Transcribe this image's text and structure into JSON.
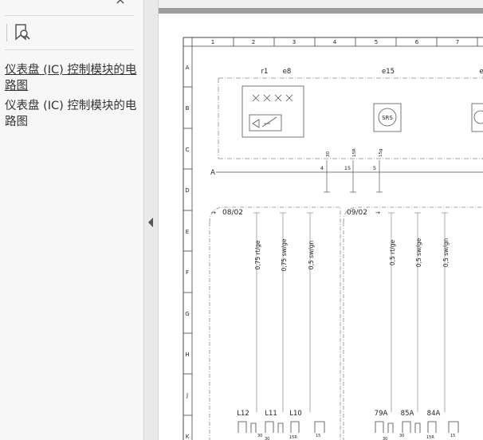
{
  "sidebar": {
    "close_glyph": "×",
    "bookmarks": [
      "仪表盘 (IC) 控制模块的电路图",
      "仪表盘 (IC) 控制模块的电路图"
    ]
  },
  "diagram": {
    "columns": [
      "1",
      "2",
      "3",
      "4",
      "5",
      "6",
      "7"
    ],
    "rows": [
      "A",
      "B",
      "C",
      "D",
      "E",
      "F",
      "G",
      "H",
      "J",
      "K"
    ],
    "component_labels": {
      "r1": "r1",
      "e8": "e8",
      "e15": "e15",
      "e_partial": "e",
      "srs": "SRS"
    },
    "bus_label": "A",
    "bus_pins": [
      "4",
      "15",
      "5"
    ],
    "bus_pin_wires": [
      "30",
      "15R",
      "15g"
    ],
    "connectors": {
      "left": "08/02",
      "right": "09/02"
    },
    "wires": [
      "0,75 rt/ge",
      "0,75 sw/ge",
      "0,5 sw/gn",
      "0,5 rt/ge",
      "0,5 sw/ge",
      "0,5 sw/gn"
    ],
    "bottom_labels": [
      "L12",
      "L11",
      "L10",
      "79A",
      "85A",
      "84A"
    ],
    "bottom_small": {
      "left": [
        "30",
        "30",
        "15R",
        "15"
      ],
      "right": [
        "30",
        "30",
        "15R",
        "15"
      ]
    }
  }
}
